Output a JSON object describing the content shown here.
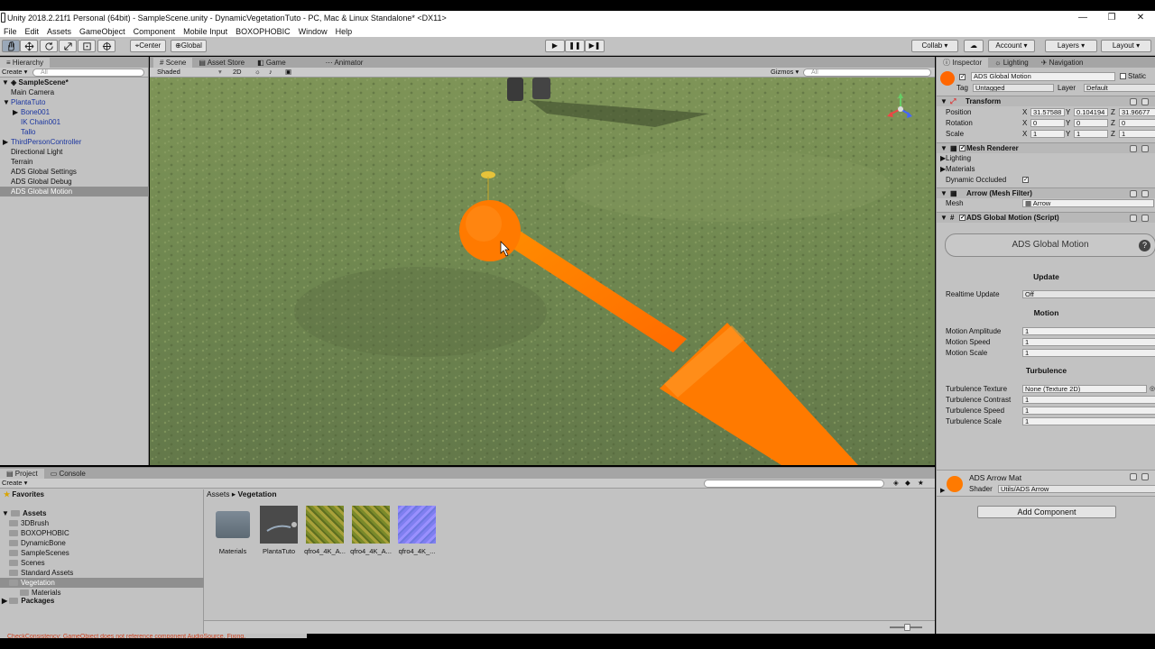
{
  "window": {
    "title": "Unity 2018.2.21f1 Personal (64bit) - SampleScene.unity - DynamicVegetationTuto - PC, Mac & Linux Standalone* <DX11>",
    "controls": [
      "—",
      "❐",
      "✕"
    ]
  },
  "menu": [
    "File",
    "Edit",
    "Assets",
    "GameObject",
    "Component",
    "Mobile Input",
    "BOXOPHOBIC",
    "Window",
    "Help"
  ],
  "toolbar": {
    "tools": [
      "hand-icon",
      "move-icon",
      "rotate-icon",
      "scale-icon",
      "rect-icon",
      "transform-icon"
    ],
    "pivot": "Center",
    "space": "Global",
    "collab": "Collab ▾",
    "account": "Account ▾",
    "layers": "Layers",
    "layout": "Layout"
  },
  "hierarchy": {
    "tab": "Hierarchy",
    "create": "Create ▾",
    "search_placeholder": "All",
    "scene": "SampleScene*",
    "items": [
      {
        "label": "Main Camera",
        "indent": 1,
        "prefab": false,
        "arrow": "",
        "selected": false
      },
      {
        "label": "PlantaTuto",
        "indent": 1,
        "prefab": true,
        "arrow": "▼",
        "selected": false
      },
      {
        "label": "Bone001",
        "indent": 2,
        "prefab": true,
        "arrow": "▶",
        "selected": false
      },
      {
        "label": "IK Chain001",
        "indent": 2,
        "prefab": true,
        "arrow": "",
        "selected": false
      },
      {
        "label": "Tallo",
        "indent": 2,
        "prefab": true,
        "arrow": "",
        "selected": false
      },
      {
        "label": "ThirdPersonController",
        "indent": 1,
        "prefab": true,
        "arrow": "▶",
        "selected": false
      },
      {
        "label": "Directional Light",
        "indent": 1,
        "prefab": false,
        "arrow": "",
        "selected": false
      },
      {
        "label": "Terrain",
        "indent": 1,
        "prefab": false,
        "arrow": "",
        "selected": false
      },
      {
        "label": "ADS Global Settings",
        "indent": 1,
        "prefab": false,
        "arrow": "",
        "selected": false
      },
      {
        "label": "ADS Global Debug",
        "indent": 1,
        "prefab": false,
        "arrow": "",
        "selected": false
      },
      {
        "label": "ADS Global Motion",
        "indent": 1,
        "prefab": false,
        "arrow": "",
        "selected": true
      }
    ]
  },
  "scene_view": {
    "tabs": [
      "Scene",
      "Asset Store",
      "Game",
      "Animator"
    ],
    "shading": "Shaded",
    "mode2d": "2D",
    "gizmos": "Gizmos ▾",
    "search_placeholder": "All"
  },
  "inspector": {
    "tabs": [
      "Inspector",
      "Lighting",
      "Navigation"
    ],
    "object_name": "ADS Global Motion",
    "static_label": "Static",
    "tag_label": "Tag",
    "tag_value": "Untagged",
    "layer_label": "Layer",
    "layer_value": "Default",
    "transform": {
      "header": "Transform",
      "position_label": "Position",
      "rotation_label": "Rotation",
      "scale_label": "Scale",
      "position": {
        "x": "31.57588",
        "y": "0.104194",
        "z": "31.96677"
      },
      "rotation": {
        "x": "0",
        "y": "0",
        "z": "0"
      },
      "scale": {
        "x": "1",
        "y": "1",
        "z": "1"
      }
    },
    "mesh_renderer": {
      "header": "Mesh Renderer",
      "lighting": "Lighting",
      "materials": "Materials",
      "dynamic_occluded": "Dynamic Occluded",
      "dynamic_occluded_check": "✓"
    },
    "mesh_filter": {
      "header": "Arrow (Mesh Filter)",
      "mesh_label": "Mesh",
      "mesh_value": "Arrow"
    },
    "script": {
      "header": "ADS Global Motion (Script)",
      "banner": "ADS Global Motion",
      "help": "?",
      "update_section": "Update",
      "realtime_label": "Realtime Update",
      "realtime_value": "Off",
      "motion_section": "Motion",
      "motion_amplitude_label": "Motion Amplitude",
      "motion_amplitude": "1",
      "motion_speed_label": "Motion Speed",
      "motion_speed": "1",
      "motion_scale_label": "Motion Scale",
      "motion_scale": "1",
      "turbulence_section": "Turbulence",
      "turb_texture_label": "Turbulence Texture",
      "turb_texture": "None (Texture 2D)",
      "turb_contrast_label": "Turbulence Contrast",
      "turb_contrast": "1",
      "turb_speed_label": "Turbulence Speed",
      "turb_speed": "1",
      "turb_scale_label": "Turbulence Scale",
      "turb_scale": "1"
    },
    "material": {
      "name": "ADS Arrow Mat",
      "shader_label": "Shader",
      "shader_value": "Utils/ADS Arrow"
    },
    "add_component": "Add Component"
  },
  "project": {
    "tabs": [
      "Project",
      "Console"
    ],
    "create": "Create ▾",
    "favorites": "Favorites",
    "assets_root": "Assets",
    "folders": [
      {
        "label": "3DBrush",
        "indent": 1,
        "selected": false
      },
      {
        "label": "BOXOPHOBIC",
        "indent": 1,
        "selected": false
      },
      {
        "label": "DynamicBone",
        "indent": 1,
        "selected": false
      },
      {
        "label": "SampleScenes",
        "indent": 1,
        "selected": false
      },
      {
        "label": "Scenes",
        "indent": 1,
        "selected": false
      },
      {
        "label": "Standard Assets",
        "indent": 1,
        "selected": false
      },
      {
        "label": "Vegetation",
        "indent": 1,
        "selected": true
      },
      {
        "label": "Materials",
        "indent": 2,
        "selected": false
      }
    ],
    "packages": "Packages",
    "breadcrumb_root": "Assets",
    "breadcrumb_sep": "▸",
    "breadcrumb_current": "Vegetation",
    "assets": [
      {
        "label": "Materials",
        "kind": "folder"
      },
      {
        "label": "PlantaTuto",
        "kind": "model"
      },
      {
        "label": "qfro4_4K_A...",
        "kind": "texture"
      },
      {
        "label": "qfro4_4K_A...",
        "kind": "texture"
      },
      {
        "label": "qfro4_4K_...",
        "kind": "normal"
      }
    ]
  },
  "status": {
    "message": "CheckConsistency: GameObject does not reference component AudioSource. Fixing."
  },
  "colors": {
    "editor_bg": "#c2c2c2",
    "arrow_orange": "#ff7a00",
    "selection": "#8f8f8f",
    "prefab_blue": "#1a35a0",
    "grass": "#7c8f55"
  }
}
